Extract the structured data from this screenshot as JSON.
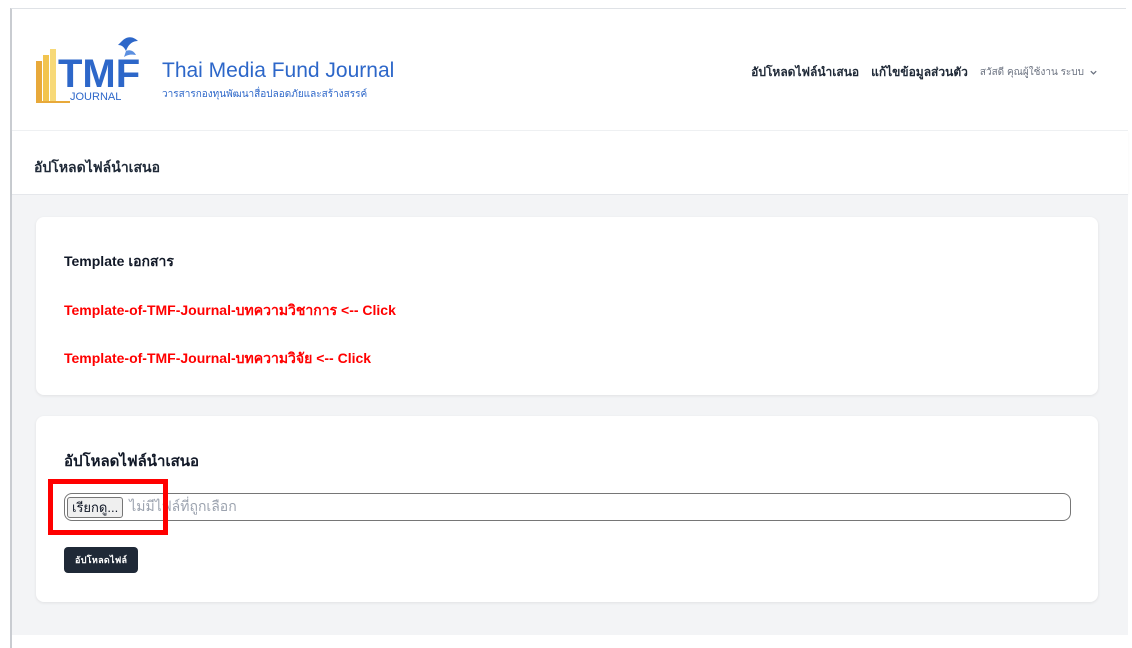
{
  "header": {
    "logo_mark": "TMF",
    "logo_sub_mark": "JOURNAL",
    "logo_title": "Thai Media Fund Journal",
    "logo_subtitle": "วารสารกองทุนพัฒนาสื่อปลอดภัยและสร้างสรรค์",
    "nav": {
      "upload": "อัปโหลดไฟล์นำเสนอ",
      "profile": "แก้ไขข้อมูลส่วนตัว",
      "user": "สวัสดี คุณผู้ใช้งาน ระบบ"
    }
  },
  "page": {
    "title": "อัปโหลดไฟล์นำเสนอ"
  },
  "templates": {
    "title": "Template เอกสาร",
    "links": [
      "Template-of-TMF-Journal-บทความวิชาการ <-- Click",
      "Template-of-TMF-Journal-บทความวิจัย <-- Click"
    ]
  },
  "upload": {
    "title": "อัปโหลดไฟล์นำเสนอ",
    "browse_label": "เรียกดู...",
    "no_file_text": "ไม่มีไฟล์ที่ถูกเลือก",
    "button_label": "อัปโหลดไฟล์"
  },
  "colors": {
    "brand_blue": "#2d67c9",
    "link_red": "#ff0000",
    "button_dark": "#1f2937",
    "highlight": "#ff0000"
  }
}
